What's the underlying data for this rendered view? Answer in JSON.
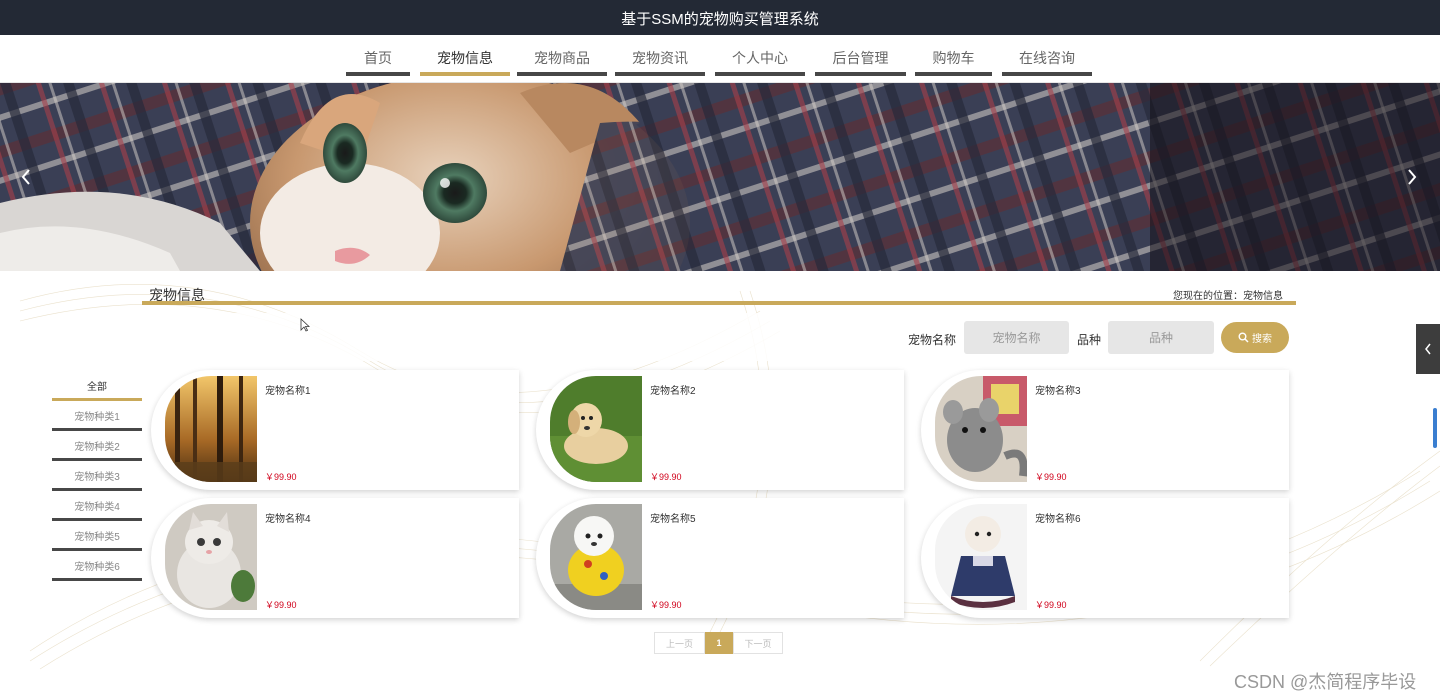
{
  "header": {
    "title": "基于SSM的宠物购买管理系统"
  },
  "nav": {
    "items": [
      {
        "label": "首页",
        "active": false
      },
      {
        "label": "宠物信息",
        "active": true
      },
      {
        "label": "宠物商品",
        "active": false
      },
      {
        "label": "宠物资讯",
        "active": false
      },
      {
        "label": "个人中心",
        "active": false
      },
      {
        "label": "后台管理",
        "active": false
      },
      {
        "label": "购物车",
        "active": false
      },
      {
        "label": "在线咨询",
        "active": false
      }
    ]
  },
  "banner": {
    "prev_icon": "chevron-left-icon",
    "next_icon": "chevron-right-icon"
  },
  "section": {
    "title": "宠物信息",
    "location_label": "您现在的位置：",
    "location_value": "宠物信息"
  },
  "search": {
    "name_label": "宠物名称",
    "name_placeholder": "宠物名称",
    "breed_label": "品种",
    "breed_placeholder": "品种",
    "button_label": "搜索",
    "button_icon": "search-icon"
  },
  "categories": [
    {
      "label": "全部",
      "active": true
    },
    {
      "label": "宠物种类1",
      "active": false
    },
    {
      "label": "宠物种类2",
      "active": false
    },
    {
      "label": "宠物种类3",
      "active": false
    },
    {
      "label": "宠物种类4",
      "active": false
    },
    {
      "label": "宠物种类5",
      "active": false
    },
    {
      "label": "宠物种类6",
      "active": false
    }
  ],
  "products": [
    {
      "name": "宠物名称1",
      "price": "￥99.90",
      "image": "forest-photo"
    },
    {
      "name": "宠物名称2",
      "price": "￥99.90",
      "image": "puppy-photo"
    },
    {
      "name": "宠物名称3",
      "price": "￥99.90",
      "image": "chinchilla-photo"
    },
    {
      "name": "宠物名称4",
      "price": "￥99.90",
      "image": "kitten-photo"
    },
    {
      "name": "宠物名称5",
      "price": "￥99.90",
      "image": "poodle-photo"
    },
    {
      "name": "宠物名称6",
      "price": "￥99.90",
      "image": "poodle-dress-photo"
    }
  ],
  "pagination": {
    "prev": "上一页",
    "current": "1",
    "next": "下一页"
  },
  "side_tab_icon": "chevron-left-icon",
  "watermark": "CSDN @杰简程序毕设",
  "colors": {
    "topbar": "#232935",
    "accent": "#c9a95a",
    "nav_underline": "#474747",
    "price": "#d0021b"
  }
}
